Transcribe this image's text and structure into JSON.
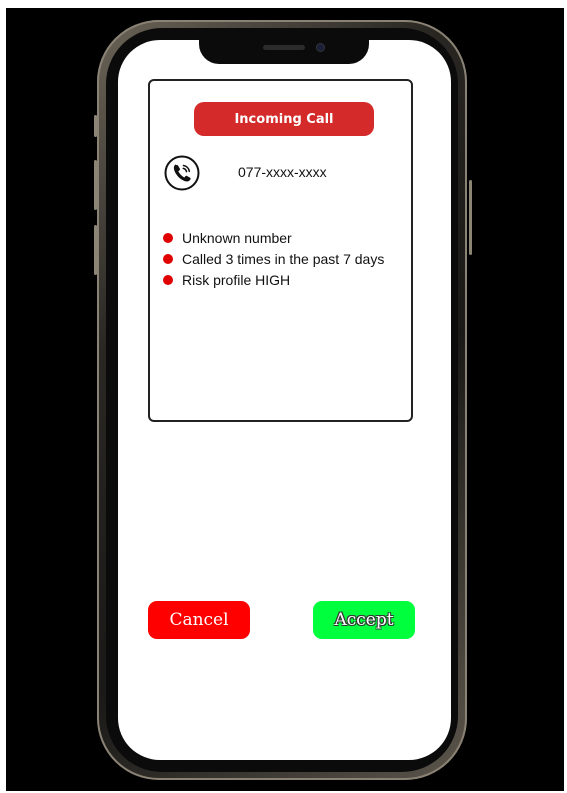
{
  "call_card": {
    "header_label": "Incoming Call",
    "caller_number": "077-xxxx-xxxx",
    "risk_indicators": [
      "Unknown number",
      "Called 3 times in the past 7 days",
      "Risk profile HIGH"
    ]
  },
  "actions": {
    "cancel_label": "Cancel",
    "accept_label": "Accept"
  },
  "icons": {
    "caller": "phone-icon",
    "indicator": "bullet-icon"
  },
  "colors": {
    "header_background": "#d42a2a",
    "bullet": "#e00000",
    "cancel_background": "#ff0000",
    "accept_background": "#00ff3c",
    "backdrop": "#000000"
  }
}
